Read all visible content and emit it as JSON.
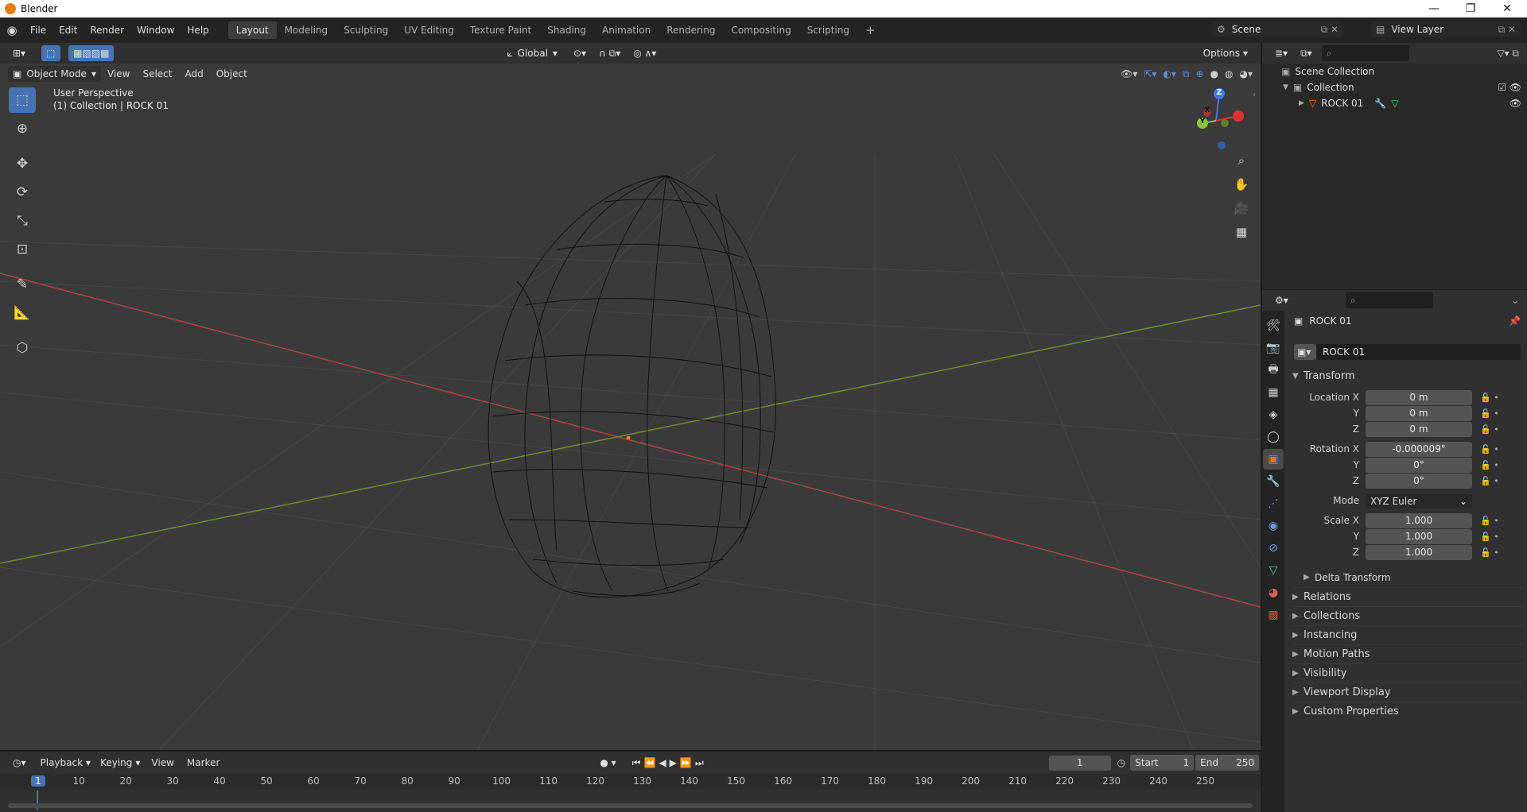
{
  "window": {
    "title": "Blender",
    "min": "—",
    "max": "❐",
    "close": "✕"
  },
  "menu": [
    "File",
    "Edit",
    "Render",
    "Window",
    "Help"
  ],
  "workspaces": [
    "Layout",
    "Modeling",
    "Sculpting",
    "UV Editing",
    "Texture Paint",
    "Shading",
    "Animation",
    "Rendering",
    "Compositing",
    "Scripting"
  ],
  "workspace_add": "+",
  "scene": {
    "name": "Scene",
    "view_layer": "View Layer"
  },
  "viewport": {
    "orientation": "Global",
    "options": "Options",
    "mode": "Object Mode",
    "menus": [
      "View",
      "Select",
      "Add",
      "Object"
    ],
    "overlay_title": "User Perspective",
    "overlay_sub": "(1) Collection | ROCK 01",
    "gizmo": {
      "z": "Z",
      "y": "Y",
      "x": "X"
    }
  },
  "outliner": {
    "scene_collection": "Scene Collection",
    "collection": "Collection",
    "object": "ROCK 01"
  },
  "properties": {
    "object_name": "ROCK 01",
    "data_name": "ROCK 01",
    "transform_title": "Transform",
    "location_label": "Location X",
    "location": [
      "0 m",
      "0 m",
      "0 m"
    ],
    "rotation_label": "Rotation X",
    "rotation": [
      "-0.000009°",
      "0°",
      "0°"
    ],
    "mode_label": "Mode",
    "mode_value": "XYZ Euler",
    "scale_label": "Scale X",
    "scale": [
      "1.000",
      "1.000",
      "1.000"
    ],
    "y": "Y",
    "z": "Z",
    "delta": "Delta Transform",
    "panels": [
      "Relations",
      "Collections",
      "Instancing",
      "Motion Paths",
      "Visibility",
      "Viewport Display",
      "Custom Properties"
    ]
  },
  "timeline": {
    "menus": [
      "Playback",
      "Keying",
      "View",
      "Marker"
    ],
    "current_frame": "1",
    "start_label": "Start",
    "start": "1",
    "end_label": "End",
    "end": "250",
    "ticks": [
      "1",
      "10",
      "20",
      "30",
      "40",
      "50",
      "60",
      "70",
      "80",
      "90",
      "100",
      "110",
      "120",
      "130",
      "140",
      "150",
      "160",
      "170",
      "180",
      "190",
      "200",
      "210",
      "220",
      "230",
      "240",
      "250"
    ]
  },
  "colors": {
    "x_axis": "#a84545",
    "y_axis": "#6c8c32",
    "z_axis": "#3f7be0",
    "active": "#4772b3",
    "accent": "#e87d0d"
  }
}
